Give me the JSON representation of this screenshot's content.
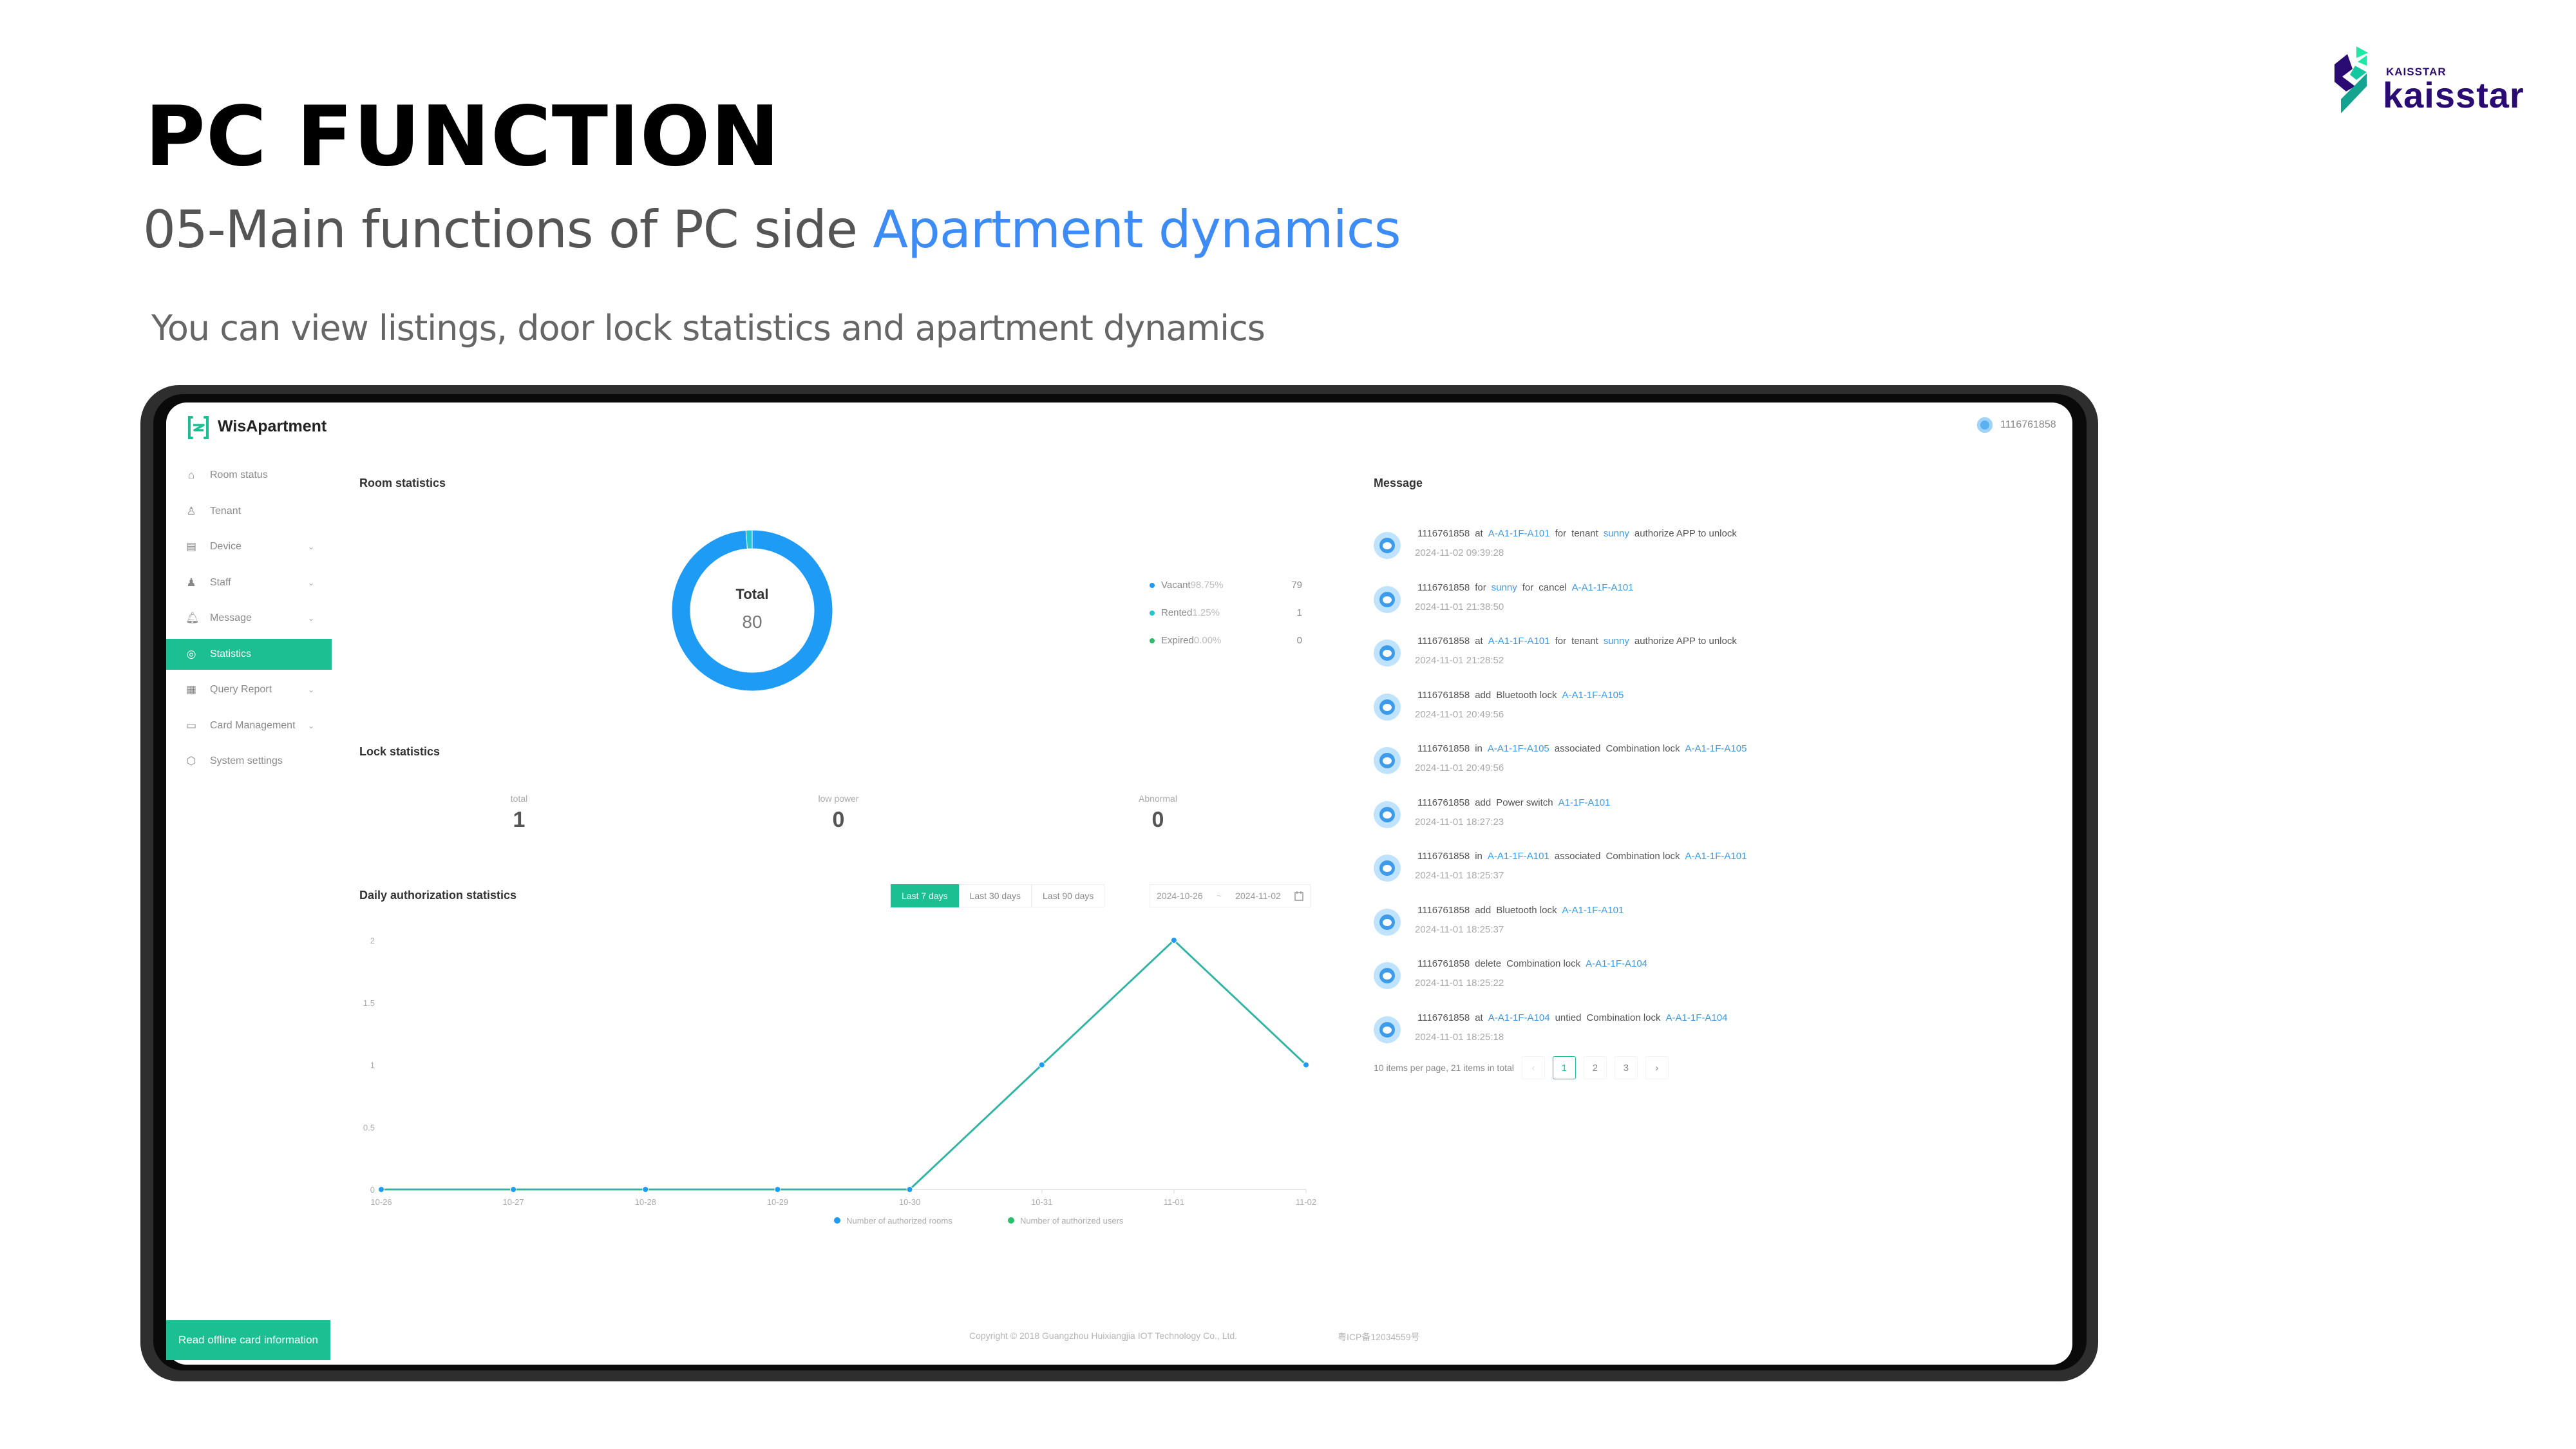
{
  "slide": {
    "title": "PC FUNCTION",
    "subtitle_prefix": "05-Main functions of PC side ",
    "subtitle_highlight": "Apartment dynamics",
    "description": "You can view listings, door lock statistics and apartment dynamics",
    "logo": {
      "small": "KAISSTAR",
      "big": "kaisstar",
      "colors": {
        "navy": "#2a0a73",
        "mint": "#1de9a4",
        "teal": "#14a38f"
      }
    }
  },
  "app": {
    "name": "WisApartment",
    "user_id": "1116761858",
    "accent": "#1cbf91",
    "sidebar": {
      "items": [
        {
          "label": "Room status",
          "icon": "home-icon",
          "has_submenu": false,
          "active": false
        },
        {
          "label": "Tenant",
          "icon": "user-icon",
          "has_submenu": false,
          "active": false
        },
        {
          "label": "Device",
          "icon": "device-icon",
          "has_submenu": true,
          "active": false
        },
        {
          "label": "Staff",
          "icon": "staff-icon",
          "has_submenu": true,
          "active": false
        },
        {
          "label": "Message",
          "icon": "bell-icon",
          "has_submenu": true,
          "active": false
        },
        {
          "label": "Statistics",
          "icon": "compass-icon",
          "has_submenu": false,
          "active": true
        },
        {
          "label": "Query Report",
          "icon": "report-icon",
          "has_submenu": true,
          "active": false
        },
        {
          "label": "Card Management",
          "icon": "card-icon",
          "has_submenu": true,
          "active": false
        },
        {
          "label": "System settings",
          "icon": "settings-icon",
          "has_submenu": false,
          "active": false
        }
      ],
      "read_card_button": "Read offline card information"
    },
    "room_statistics": {
      "title": "Room statistics",
      "center_label": "Total",
      "center_value": "80",
      "legend": [
        {
          "name": "Vacant",
          "pct": "98.75%",
          "count": "79",
          "color": "#1e9bf5"
        },
        {
          "name": "Rented",
          "pct": "1.25%",
          "count": "1",
          "color": "#26c6d0"
        },
        {
          "name": "Expired",
          "pct": "0.00%",
          "count": "0",
          "color": "#2bbf6a"
        }
      ]
    },
    "lock_statistics": {
      "title": "Lock statistics",
      "items": [
        {
          "label": "total",
          "value": "1"
        },
        {
          "label": "low power",
          "value": "0"
        },
        {
          "label": "Abnormal",
          "value": "0"
        }
      ]
    },
    "daily_auth": {
      "title": "Daily authorization statistics",
      "ranges": [
        {
          "label": "Last 7 days",
          "active": true
        },
        {
          "label": "Last 30 days",
          "active": false
        },
        {
          "label": "Last 90 days",
          "active": false
        }
      ],
      "date_start": "2024-10-26",
      "date_sep": "~",
      "date_end": "2024-11-02"
    },
    "messages": {
      "title": "Message",
      "items": [
        {
          "parts": [
            [
              "1116761858",
              0
            ],
            [
              "at",
              0
            ],
            [
              "A-A1-1F-A101",
              1
            ],
            [
              "for",
              0
            ],
            [
              "tenant",
              0
            ],
            [
              "sunny",
              1
            ],
            [
              "authorize APP to unlock",
              0
            ]
          ],
          "time": "2024-11-02 09:39:28"
        },
        {
          "parts": [
            [
              "1116761858",
              0
            ],
            [
              "for",
              0
            ],
            [
              "sunny",
              1
            ],
            [
              "for",
              0
            ],
            [
              "cancel",
              0
            ],
            [
              "A-A1-1F-A101",
              1
            ]
          ],
          "time": "2024-11-01 21:38:50"
        },
        {
          "parts": [
            [
              "1116761858",
              0
            ],
            [
              "at",
              0
            ],
            [
              "A-A1-1F-A101",
              1
            ],
            [
              "for",
              0
            ],
            [
              "tenant",
              0
            ],
            [
              "sunny",
              1
            ],
            [
              "authorize APP to unlock",
              0
            ]
          ],
          "time": "2024-11-01 21:28:52"
        },
        {
          "parts": [
            [
              "1116761858",
              0
            ],
            [
              "add",
              0
            ],
            [
              "Bluetooth lock",
              0
            ],
            [
              "A-A1-1F-A105",
              1
            ]
          ],
          "time": "2024-11-01 20:49:56"
        },
        {
          "parts": [
            [
              "1116761858",
              0
            ],
            [
              "in",
              0
            ],
            [
              "A-A1-1F-A105",
              1
            ],
            [
              "associated",
              0
            ],
            [
              "Combination lock",
              0
            ],
            [
              "A-A1-1F-A105",
              1
            ]
          ],
          "time": "2024-11-01 20:49:56"
        },
        {
          "parts": [
            [
              "1116761858",
              0
            ],
            [
              "add",
              0
            ],
            [
              "Power switch",
              0
            ],
            [
              "A1-1F-A101",
              1
            ]
          ],
          "time": "2024-11-01 18:27:23"
        },
        {
          "parts": [
            [
              "1116761858",
              0
            ],
            [
              "in",
              0
            ],
            [
              "A-A1-1F-A101",
              1
            ],
            [
              "associated",
              0
            ],
            [
              "Combination lock",
              0
            ],
            [
              "A-A1-1F-A101",
              1
            ]
          ],
          "time": "2024-11-01 18:25:37"
        },
        {
          "parts": [
            [
              "1116761858",
              0
            ],
            [
              "add",
              0
            ],
            [
              "Bluetooth lock",
              0
            ],
            [
              "A-A1-1F-A101",
              1
            ]
          ],
          "time": "2024-11-01 18:25:37"
        },
        {
          "parts": [
            [
              "1116761858",
              0
            ],
            [
              "delete",
              0
            ],
            [
              "Combination lock",
              0
            ],
            [
              "A-A1-1F-A104",
              1
            ]
          ],
          "time": "2024-11-01 18:25:22"
        },
        {
          "parts": [
            [
              "1116761858",
              0
            ],
            [
              "at",
              0
            ],
            [
              "A-A1-1F-A104",
              1
            ],
            [
              "untied",
              0
            ],
            [
              "Combination lock",
              0
            ],
            [
              "A-A1-1F-A104",
              1
            ]
          ],
          "time": "2024-11-01 18:25:18"
        }
      ],
      "pagination": {
        "summary": "10 items per page, 21 items in total",
        "pages": [
          "1",
          "2",
          "3"
        ],
        "current": "1",
        "prev": "‹",
        "next": "›"
      }
    },
    "footer": {
      "copyright": "Copyright © 2018 Guangzhou Huixiangjia IOT Technology Co., Ltd.",
      "icp": "粤ICP备12034559号"
    }
  },
  "chart_data": [
    {
      "type": "pie",
      "title": "Room statistics",
      "donut": true,
      "center_text": [
        "Total",
        "80"
      ],
      "categories": [
        "Vacant",
        "Rented",
        "Expired"
      ],
      "values": [
        79,
        1,
        0
      ],
      "percentages": [
        "98.75%",
        "1.25%",
        "0.00%"
      ],
      "colors": [
        "#1e9bf5",
        "#26c6d0",
        "#2bbf6a"
      ],
      "legend": "right"
    },
    {
      "type": "line",
      "title": "Daily authorization statistics",
      "categories": [
        "10-26",
        "10-27",
        "10-28",
        "10-29",
        "10-30",
        "10-31",
        "11-01",
        "11-02"
      ],
      "series": [
        {
          "name": "Number of authorized rooms",
          "color": "#1e9bf5",
          "values": [
            0,
            0,
            0,
            0,
            0,
            1,
            2,
            1
          ]
        },
        {
          "name": "Number of authorized users",
          "color": "#2bbf6a",
          "values": [
            0,
            0,
            0,
            0,
            0,
            1,
            2,
            1
          ]
        }
      ],
      "yticks": [
        "0",
        "0.5",
        "1",
        "1.5",
        "2"
      ],
      "ylim": [
        0,
        2
      ],
      "xlabel": "",
      "ylabel": "",
      "grid": false,
      "legend": "bottom"
    }
  ]
}
